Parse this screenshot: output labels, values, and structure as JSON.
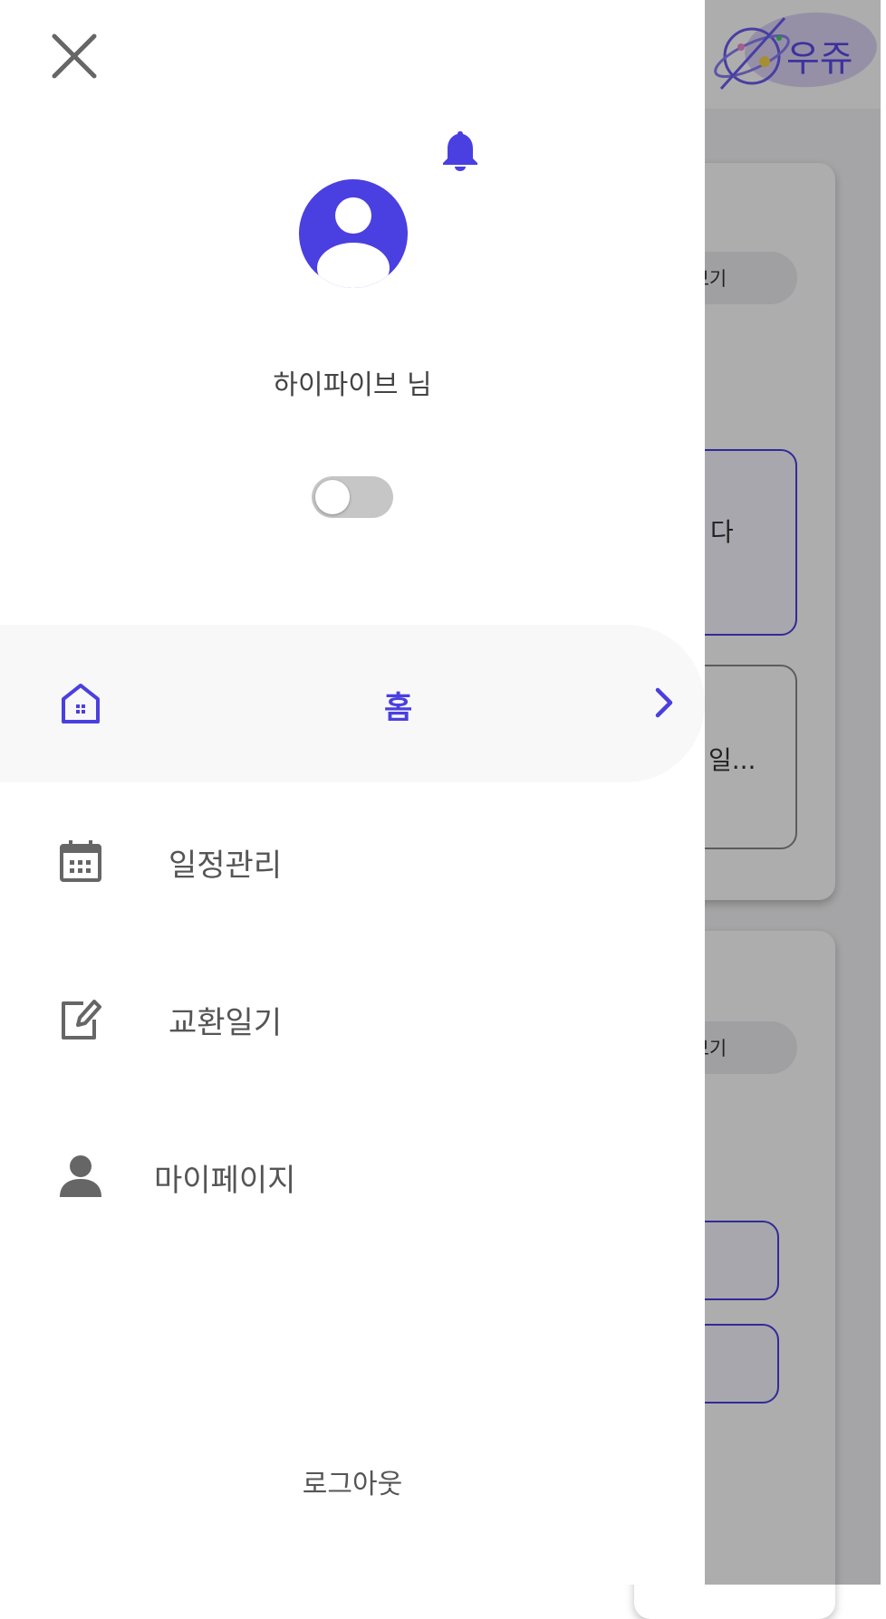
{
  "background": {
    "logo_text": "우쥬",
    "cards": [
      {
        "more_label": "+ 더보기",
        "item_text_1": "다",
        "item_text_2": "일..."
      },
      {
        "more_label": "+ 더보기"
      }
    ]
  },
  "drawer": {
    "user_name": "하이파이브 님",
    "dark_mode_on": false,
    "menu": [
      {
        "label": "홈",
        "icon": "home-icon",
        "active": true
      },
      {
        "label": "일정관리",
        "icon": "calendar-icon",
        "active": false
      },
      {
        "label": "교환일기",
        "icon": "edit-note-icon",
        "active": false
      },
      {
        "label": "마이페이지",
        "icon": "person-icon",
        "active": false
      }
    ],
    "logout_label": "로그아웃"
  },
  "colors": {
    "accent": "#4a3fe0",
    "scrim": "rgba(0,0,0,0.32)",
    "icon_gray": "#666666"
  }
}
